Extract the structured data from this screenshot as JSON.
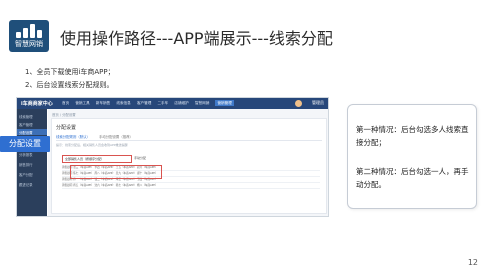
{
  "logo": {
    "text": "智慧网销"
  },
  "title": "使用操作路径---APP端展示---线索分配",
  "steps": [
    "1、全员下载使用i车商APP；",
    "2、后台设置线索分配规则。"
  ],
  "screenshot": {
    "brand": "i车商商家中心",
    "top_menus": [
      "首页",
      "营销工具",
      "新车销售",
      "线索信息",
      "客户管理",
      "二手车",
      "店铺维护",
      "智慧网销",
      "营销管理"
    ],
    "active_menu": "营销管理",
    "user": "管理员",
    "side_items": [
      "线索管理",
      "客户管理",
      "分配设置",
      "线索统计",
      "分析报表",
      "销售排行",
      "客户分配",
      "跟进记录"
    ],
    "side_active": "分配设置",
    "callout": "分配设置",
    "breadcrumb": "首页 / 分配设置",
    "panel_title": "分配设置",
    "tabs": [
      "线索分配规则（默认）",
      "手动分配设置（推荐）"
    ],
    "note": "提示：线索分配后，相关销售人员会收到APP推送提醒",
    "select_value": "全部销售人员（按顺序分配）",
    "select2": "手动分配",
    "grid_rows": [
      "销售顾问  张三（车商APP）  李四（车商APP）  王五（车商APP）  赵六（车商APP）",
      "销售顾问  陈七（车商APP）  周八（车商APP）  吴九（车商APP）  郑十（车商APP）",
      "销售顾问  孙一（车商APP）  钱二（车商APP）  冯三（车商APP）  卫四（车商APP）",
      "销售顾问  蒋五（车商APP）  沈六（车商APP）  韩七（车商APP）  杨八（车商APP）"
    ]
  },
  "card": {
    "case1": "第一种情况：后台勾选多人线索直接分配；",
    "case2": "第二种情况：后台勾选一人，再手动分配。"
  },
  "page_number": "12",
  "colors": {
    "nav": "#27477a",
    "callout": "#2f6fd1",
    "logo_bg": "#1f4f7a"
  }
}
